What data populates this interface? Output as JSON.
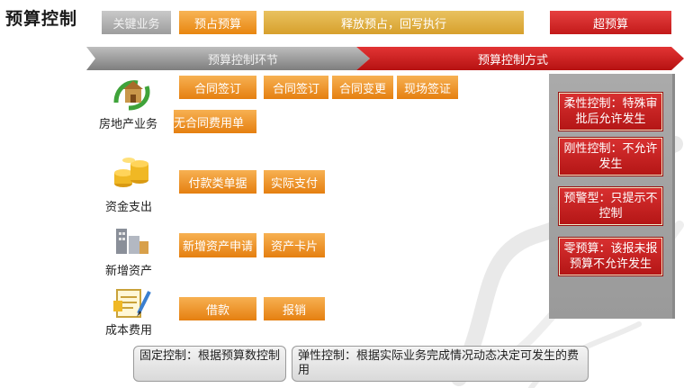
{
  "title": "预算控制",
  "header": {
    "key_business": "关键业务",
    "pre_occupy": "预占预算",
    "release": "释放预占，回写执行",
    "over_budget": "超预算"
  },
  "band": {
    "left_label": "预算控制环节",
    "right_label": "预算控制方式"
  },
  "rows": [
    {
      "label": "房地产业务",
      "icon": "house-coins-icon",
      "boxes": [
        "合同签订",
        "合同签订",
        "合同变更",
        "现场签证",
        "无合同费用单"
      ]
    },
    {
      "label": "资金支出",
      "icon": "coin-stack-icon",
      "boxes": [
        "付款类单据",
        "实际支付"
      ]
    },
    {
      "label": "新增资产",
      "icon": "buildings-icon",
      "boxes": [
        "新增资产申请",
        "资产卡片"
      ]
    },
    {
      "label": "成本费用",
      "icon": "document-pencil-icon",
      "boxes": [
        "借款",
        "报销"
      ]
    }
  ],
  "controls": [
    "柔性控制：特殊审批后允许发生",
    "刚性控制：不允许发生",
    "预警型：只提示不控制",
    "零预算：该报未报预算不允许发生"
  ],
  "notes": {
    "fixed": "固定控制：根据预算数控制",
    "flexible": "弹性控制：根据实际业务完成情况动态决定可发生的费用"
  },
  "colors": {
    "orange": "#e8860f",
    "red": "#c31a1a",
    "gray": "#9d9d9d"
  }
}
